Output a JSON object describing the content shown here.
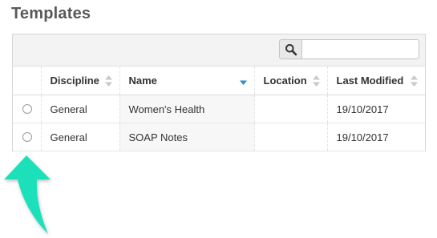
{
  "page": {
    "title": "Templates"
  },
  "search": {
    "placeholder": "",
    "value": ""
  },
  "table": {
    "columns": [
      "",
      "Discipline",
      "Name",
      "Location",
      "Last Modified"
    ],
    "rows": [
      {
        "discipline": "General",
        "name": "Women's Health",
        "location": "",
        "last_modified": "19/10/2017"
      },
      {
        "discipline": "General",
        "name": "SOAP Notes",
        "location": "",
        "last_modified": "19/10/2017"
      }
    ]
  },
  "sort": {
    "active_column": "Name",
    "direction": "descending"
  },
  "colors": {
    "accent": "#2a8fbd",
    "annotation_arrow": "#1fe0ba"
  }
}
